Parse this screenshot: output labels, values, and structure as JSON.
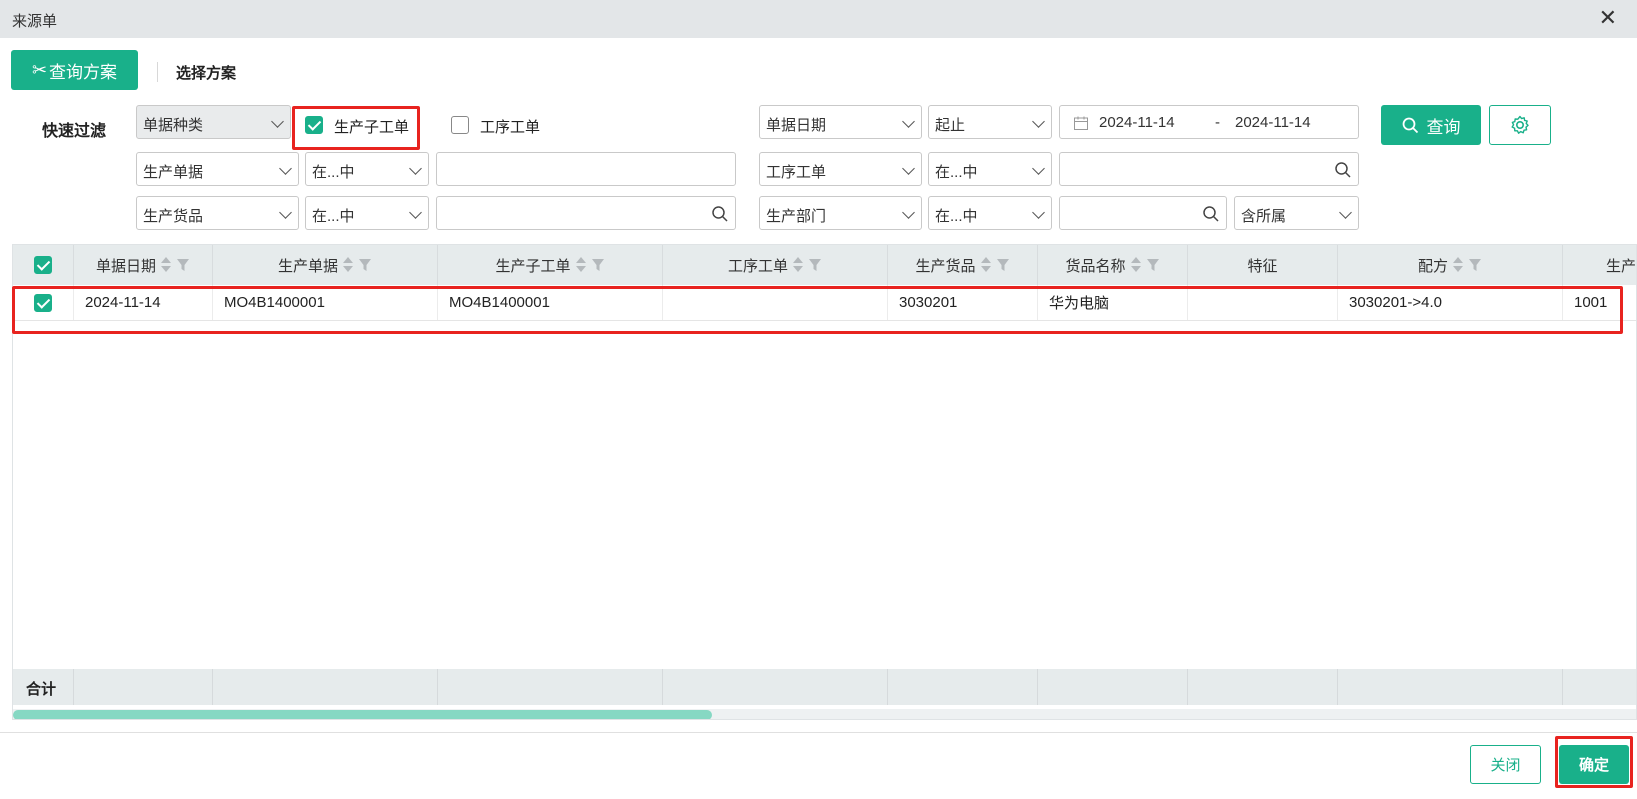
{
  "window": {
    "title": "来源单",
    "close_icon": "close-icon"
  },
  "toolbar": {
    "query_scheme_label": "查询方案",
    "select_scheme_label": "选择方案"
  },
  "filters": {
    "quick_filter_label": "快速过滤",
    "doc_type": {
      "value": "单据种类"
    },
    "option_production_sub_order": {
      "label": "生产子工单",
      "checked": true
    },
    "option_process_order": {
      "label": "工序工单",
      "checked": false
    },
    "date_field": "单据日期",
    "date_operator": "起止",
    "date_start": "2024-11-14",
    "date_separator": "-",
    "date_end": "2024-11-14",
    "query_button": "查询",
    "row2": {
      "field_left": "生产单据",
      "op_left": "在...中",
      "value_left": "",
      "field_right": "工序工单",
      "op_right": "在...中",
      "value_right": ""
    },
    "row3": {
      "field_left": "生产货品",
      "op_left": "在...中",
      "value_left": "",
      "field_right": "生产部门",
      "op_right": "在...中",
      "value_right": "",
      "extra": "含所属"
    }
  },
  "grid": {
    "columns": [
      "单据日期",
      "生产单据",
      "生产子工单",
      "工序工单",
      "生产货品",
      "货品名称",
      "特征",
      "配方",
      "生产"
    ],
    "rows": [
      {
        "checked": true,
        "cells": [
          "2024-11-14",
          "MO4B1400001",
          "MO4B1400001",
          "",
          "3030201",
          "华为电脑",
          "",
          "3030201->4.0",
          "1001"
        ]
      }
    ],
    "total_label": "合计",
    "scroll_position": 0.43
  },
  "footer": {
    "close_label": "关闭",
    "ok_label": "确定"
  },
  "colors": {
    "accent": "#19b08a",
    "highlight": "#e8231f"
  }
}
